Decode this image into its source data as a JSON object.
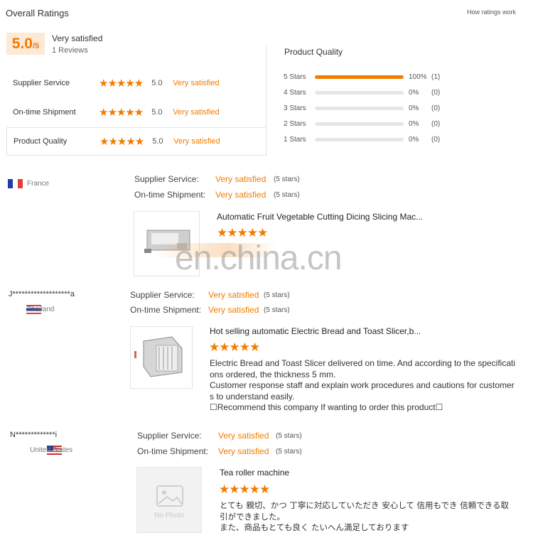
{
  "header": {
    "title": "Overall Ratings",
    "how_link": "How ratings work"
  },
  "overall": {
    "score": "5.0",
    "score_suffix": "/5",
    "label": "Very satisfied",
    "reviews": "1 Reviews"
  },
  "categories": [
    {
      "name": "Supplier Service",
      "stars": "★★★★★",
      "value": "5.0",
      "label": "Very satisfied"
    },
    {
      "name": "On-time Shipment",
      "stars": "★★★★★",
      "value": "5.0",
      "label": "Very satisfied"
    },
    {
      "name": "Product Quality",
      "stars": "★★★★★",
      "value": "5.0",
      "label": "Very satisfied"
    }
  ],
  "product_quality": {
    "title": "Product Quality",
    "rows": [
      {
        "label": "5  Stars",
        "fraction": 1.0,
        "pct": "100%",
        "count": "(1)"
      },
      {
        "label": "4  Stars",
        "fraction": 0.0,
        "pct": "0%",
        "count": "(0)"
      },
      {
        "label": "3  Stars",
        "fraction": 0.0,
        "pct": "0%",
        "count": "(0)"
      },
      {
        "label": "2  Stars",
        "fraction": 0.0,
        "pct": "0%",
        "count": "(0)"
      },
      {
        "label": "1  Stars",
        "fraction": 0.0,
        "pct": "0%",
        "count": "(0)"
      }
    ]
  },
  "watermark": "en.china.cn",
  "reviews": [
    {
      "user": "",
      "country": "France",
      "supplier_label": "Supplier Service:",
      "supplier_value": "Very satisfied",
      "supplier_stars": "(5 stars)",
      "shipment_label": "On-time Shipment:",
      "shipment_value": "Very satisfied",
      "shipment_stars": "(5 stars)",
      "product_title": "Automatic Fruit Vegetable Cutting Dicing Slicing Mac...",
      "product_stars": "★★★★★",
      "text": []
    },
    {
      "user": "J*******************a",
      "country": "Thailand",
      "supplier_label": "Supplier Service:",
      "supplier_value": "Very satisfied",
      "supplier_stars": "(5 stars)",
      "shipment_label": "On-time Shipment:",
      "shipment_value": "Very satisfied",
      "shipment_stars": "(5 stars)",
      "product_title": "Hot selling automatic Electric Bread and Toast Slicer,b...",
      "product_stars": "★★★★★",
      "text": [
        "Electric Bread and Toast Slicer delivered on time. And according to the specificati",
        "ons ordered, the thickness 5 mm.",
        "Customer response staff and explain work procedures and cautions for customer",
        "s to understand easily.",
        "☐Recommend this company If wanting to order this product☐"
      ]
    },
    {
      "user": "N*************i",
      "country": "United States",
      "supplier_label": "Supplier Service:",
      "supplier_value": "Very satisfied",
      "supplier_stars": "(5 stars)",
      "shipment_label": "On-time Shipment:",
      "shipment_value": "Very satisfied",
      "shipment_stars": "(5 stars)",
      "product_title": "Tea roller machine",
      "product_stars": "★★★★★",
      "no_photo": "No Photo",
      "text": [
        "とても 親切、かつ 丁寧に対応していただき 安心して 信用もでき 信頼できる取",
        "引ができました。",
        "また、商品もとても良く たいへん満足しております"
      ]
    }
  ]
}
